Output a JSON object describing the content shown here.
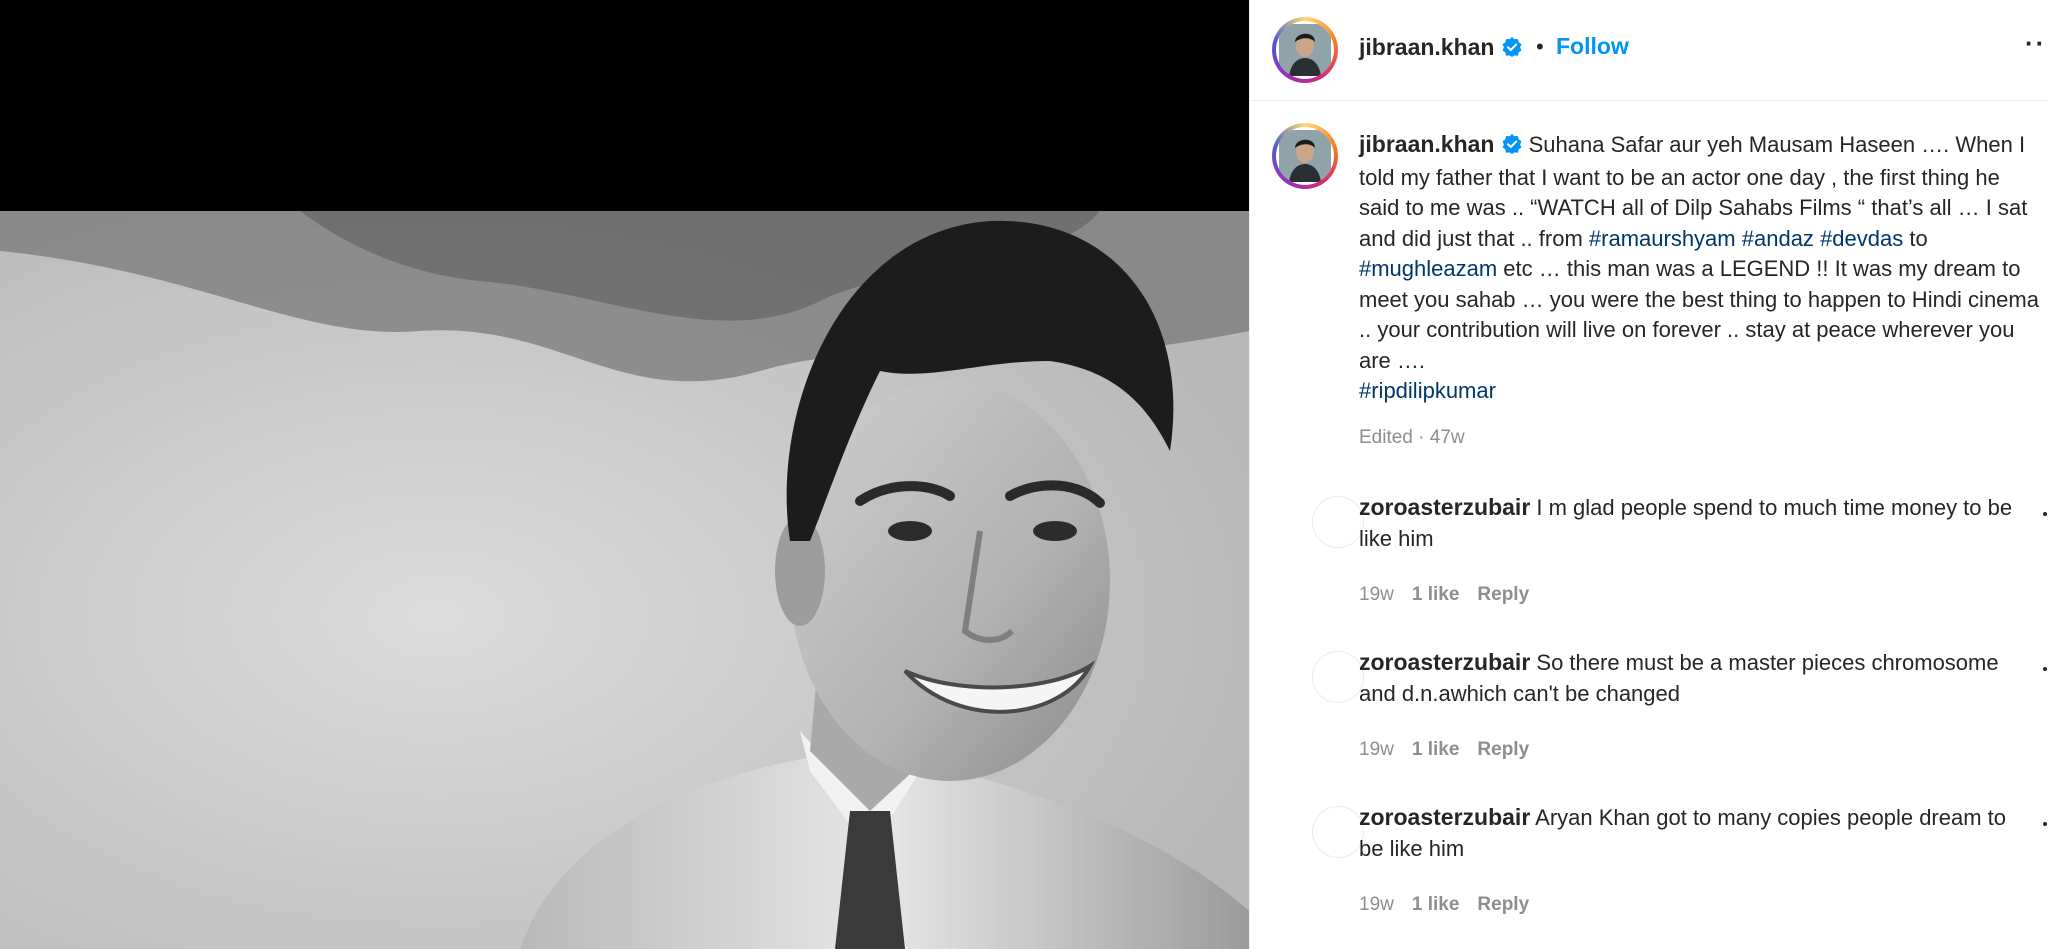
{
  "header": {
    "username": "jibraan.khan",
    "separator": "•",
    "follow_label": "Follow",
    "more_label": "··"
  },
  "caption": {
    "username": "jibraan.khan",
    "text_1": "Suhana Safar aur yeh Mausam Haseen …. When I told my father that I want to be an actor one day , the first thing he said to me was .. “WATCH all of Dilp Sahabs Films “ that’s all … I sat and did just that .. from ",
    "tag_1": "#ramaurshyam",
    "space_1": " ",
    "tag_2": "#andaz",
    "space_2": " ",
    "tag_3": "#devdas",
    "text_2": " to ",
    "tag_4": "#mughleazam",
    "text_3": " etc … this man was a LEGEND !! It was my dream to meet you sahab … you were the best thing to happen to Hindi cinema .. your contribution will live on forever .. stay at peace wherever you are ….",
    "tag_5": "#ripdilipkumar",
    "edited": "Edited · 47w"
  },
  "comments": [
    {
      "username": "zoroasterzubair",
      "text": "I m glad people spend to much time money to be like him",
      "age": "19w",
      "likes": "1 like",
      "reply": "Reply"
    },
    {
      "username": "zoroasterzubair",
      "text": "So there must be a master pieces chromosome and d.n.awhich can't be changed",
      "age": "19w",
      "likes": "1 like",
      "reply": "Reply"
    },
    {
      "username": "zoroasterzubair",
      "text": "Aryan Khan got to many copies people dream to be like him",
      "age": "19w",
      "likes": "1 like",
      "reply": "Reply"
    }
  ],
  "colors": {
    "link_blue": "#0095f6",
    "hashtag": "#00376b",
    "secondary_text": "#8e8e8e",
    "verified_badge": "#0095f6"
  },
  "icons": {
    "verified": "verified-badge-icon",
    "more": "more-options-icon",
    "comment_like": "heart-icon"
  }
}
